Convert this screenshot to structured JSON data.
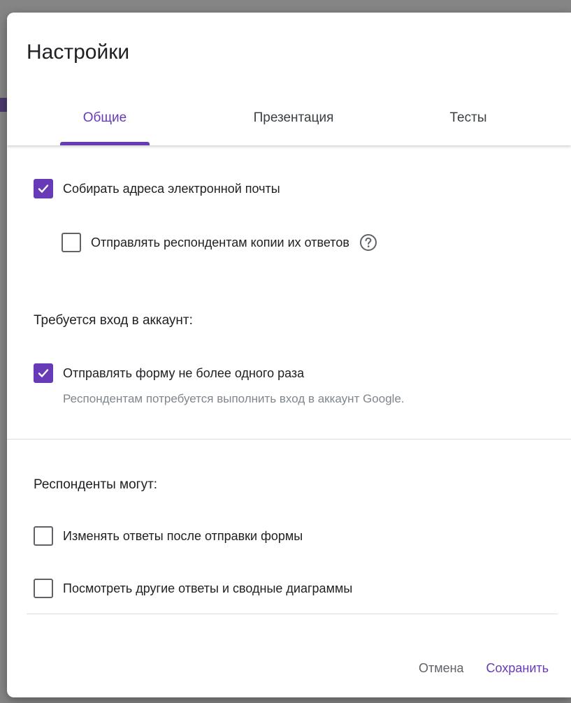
{
  "dialog": {
    "title": "Настройки"
  },
  "tabs": [
    {
      "label": "Общие",
      "active": true
    },
    {
      "label": "Презентация",
      "active": false
    },
    {
      "label": "Тесты",
      "active": false
    }
  ],
  "general": {
    "collect_emails": {
      "label": "Собирать адреса электронной почты",
      "checked": true
    },
    "send_copies": {
      "label": "Отправлять респондентам копии их ответов",
      "checked": false,
      "icon": "help-circle-icon"
    },
    "login_required_heading": "Требуется вход в аккаунт:",
    "limit_one_response": {
      "label": "Отправлять форму не более одного раза",
      "note": "Респондентам потребуется выполнить вход в аккаунт Google.",
      "checked": true
    },
    "respondents_can_heading": "Респонденты могут:",
    "edit_after_submit": {
      "label": "Изменять ответы после отправки формы",
      "checked": false
    },
    "see_summary": {
      "label": "Посмотреть другие ответы и сводные диаграммы",
      "checked": false
    }
  },
  "actions": {
    "cancel_label": "Отмена",
    "save_label": "Сохранить"
  },
  "colors": {
    "accent": "#673ab7",
    "text": "#202124",
    "muted": "#80868b",
    "overlay": "#7d7d7d"
  }
}
